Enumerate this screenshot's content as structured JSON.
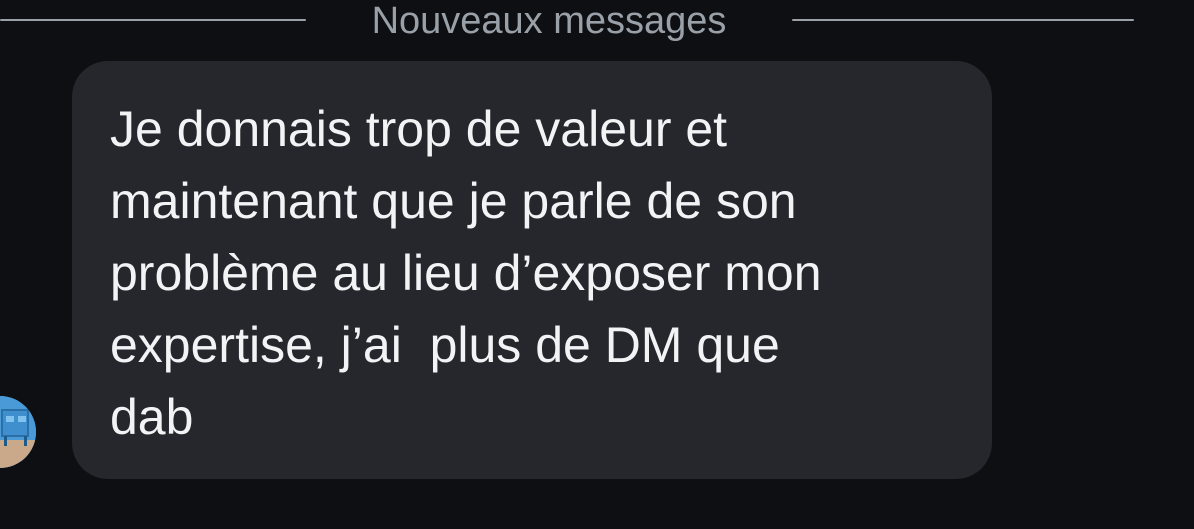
{
  "divider": {
    "label": "Nouveaux messages"
  },
  "message": {
    "lines": [
      "Je donnais trop de valeur et",
      "maintenant que je parle de son",
      "problème au lieu d’exposer mon",
      "expertise, j’ai  plus de DM que",
      "dab"
    ]
  },
  "avatar": {
    "icon": "user-avatar-photo",
    "colors": {
      "sky": "#4b9ad8",
      "sand": "#c9a98a"
    }
  },
  "colors": {
    "background": "#0d0f13",
    "bubble": "#25272c",
    "text": "#f2f3f5",
    "divider": "#9aa0a8"
  }
}
